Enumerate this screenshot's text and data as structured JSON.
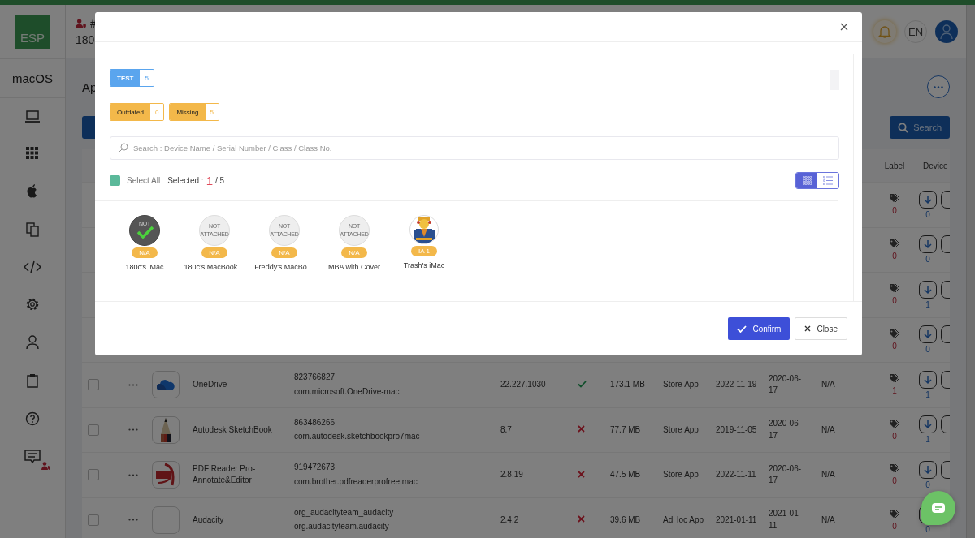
{
  "header": {
    "title_fragment": "#",
    "subtitle_fragment": "180",
    "language": "EN"
  },
  "sidebar": {
    "logo": "ESP",
    "platform": "macOS"
  },
  "page": {
    "title_fragment": "Ap",
    "search_button": "Search"
  },
  "table": {
    "columns": [
      "Label",
      "Device"
    ],
    "rows": [
      {
        "label_count": "0",
        "download_count": "0"
      },
      {
        "label_count": "0",
        "download_count": "0"
      },
      {
        "label_count": "0",
        "download_count": "1"
      },
      {
        "label_count": "0",
        "download_count": "0"
      },
      {
        "checked": false,
        "name": "OneDrive",
        "app_id": "823766827",
        "bundle_id": "com.microsoft.OneDrive-mac",
        "version": "22.227.1030",
        "installed": true,
        "size": "173.1 MB",
        "type": "Store App",
        "date_1": "2022-11-19",
        "date_2": "2020-06-17",
        "column_n_a": "N/A",
        "label_count": "1",
        "download_count": "1"
      },
      {
        "checked": false,
        "name": "Autodesk SketchBook",
        "app_id": "863486266",
        "bundle_id": "com.autodesk.sketchbookpro7mac",
        "version": "8.7",
        "installed": false,
        "size": "77.7 MB",
        "type": "Store App",
        "date_1": "2019-11-05",
        "date_2": "2020-06-17",
        "column_n_a": "N/A",
        "label_count": "0",
        "download_count": "1"
      },
      {
        "checked": false,
        "name": "PDF Reader Pro-Annotate&Editor",
        "app_id": "919472673",
        "bundle_id": "com.brother.pdfreaderprofree.mac",
        "version": "2.8.19",
        "installed": false,
        "size": "47.5 MB",
        "type": "Store App",
        "date_1": "2022-11-11",
        "date_2": "2020-06-17",
        "column_n_a": "N/A",
        "label_count": "0",
        "download_count": "0"
      },
      {
        "checked": false,
        "name": "Audacity",
        "app_id": "org_audacityteam_audacity",
        "bundle_id": "org.audacityteam.audacity",
        "version": "2.4.2",
        "installed": false,
        "size": "39.6 MB",
        "type": "AdHoc App",
        "date_1": "2021-01-11",
        "date_2": "2021-01-11",
        "column_n_a": "N/A",
        "label_count": "0",
        "download_count": "0"
      }
    ]
  },
  "modal": {
    "groups": [
      {
        "label": "TEST",
        "count": "5"
      }
    ],
    "statuses": [
      {
        "label": "Outdated",
        "count": "0"
      },
      {
        "label": "Missing",
        "count": "5"
      }
    ],
    "search_placeholder": "Search : Device Name / Serial Number / Class / Class No.",
    "select_all": {
      "label": "Select All",
      "checked": false
    },
    "selected_label": "Selected :",
    "selected_count": "1",
    "selected_total": "/ 5",
    "views": [
      {
        "kind": "grid",
        "selected": true
      },
      {
        "kind": "list",
        "selected": false
      }
    ],
    "devices": [
      {
        "name": "180c's iMac",
        "badge": "N/A",
        "avatar_text": "NOT",
        "selected": true
      },
      {
        "name": "180c's MacBook…",
        "badge": "N/A",
        "avatar_text": "NOT ATTACHED",
        "selected": false
      },
      {
        "name": "Freddy's MacBo…",
        "badge": "N/A",
        "avatar_text": "NOT ATTACHED",
        "selected": false
      },
      {
        "name": "MBA with Cover",
        "badge": "N/A",
        "avatar_text": "NOT ATTACHED",
        "selected": false
      },
      {
        "name": "Trash's iMac",
        "badge": "IA 1",
        "kind": "picture",
        "selected": false
      }
    ],
    "confirm_button": "Confirm",
    "close_button": "Close"
  }
}
